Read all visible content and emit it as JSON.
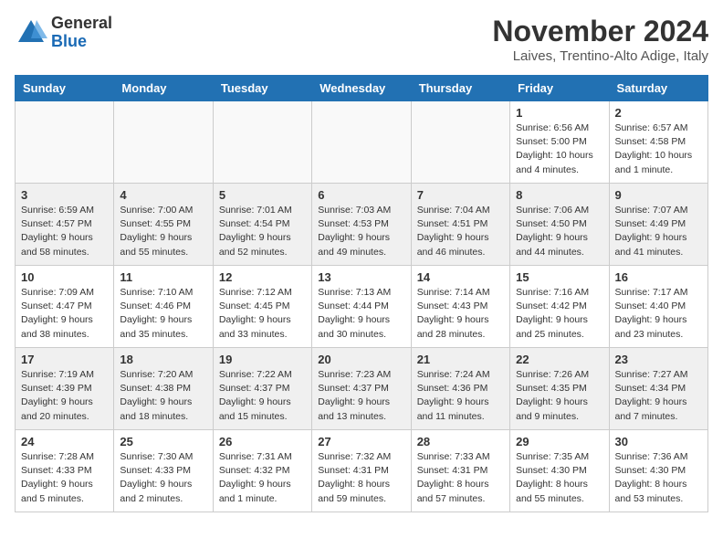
{
  "header": {
    "logo_general": "General",
    "logo_blue": "Blue",
    "month_title": "November 2024",
    "location": "Laives, Trentino-Alto Adige, Italy"
  },
  "columns": [
    "Sunday",
    "Monday",
    "Tuesday",
    "Wednesday",
    "Thursday",
    "Friday",
    "Saturday"
  ],
  "weeks": [
    [
      {
        "day": "",
        "info": "",
        "empty": true
      },
      {
        "day": "",
        "info": "",
        "empty": true
      },
      {
        "day": "",
        "info": "",
        "empty": true
      },
      {
        "day": "",
        "info": "",
        "empty": true
      },
      {
        "day": "",
        "info": "",
        "empty": true
      },
      {
        "day": "1",
        "info": "Sunrise: 6:56 AM\nSunset: 5:00 PM\nDaylight: 10 hours\nand 4 minutes.",
        "empty": false
      },
      {
        "day": "2",
        "info": "Sunrise: 6:57 AM\nSunset: 4:58 PM\nDaylight: 10 hours\nand 1 minute.",
        "empty": false
      }
    ],
    [
      {
        "day": "3",
        "info": "Sunrise: 6:59 AM\nSunset: 4:57 PM\nDaylight: 9 hours\nand 58 minutes.",
        "empty": false
      },
      {
        "day": "4",
        "info": "Sunrise: 7:00 AM\nSunset: 4:55 PM\nDaylight: 9 hours\nand 55 minutes.",
        "empty": false
      },
      {
        "day": "5",
        "info": "Sunrise: 7:01 AM\nSunset: 4:54 PM\nDaylight: 9 hours\nand 52 minutes.",
        "empty": false
      },
      {
        "day": "6",
        "info": "Sunrise: 7:03 AM\nSunset: 4:53 PM\nDaylight: 9 hours\nand 49 minutes.",
        "empty": false
      },
      {
        "day": "7",
        "info": "Sunrise: 7:04 AM\nSunset: 4:51 PM\nDaylight: 9 hours\nand 46 minutes.",
        "empty": false
      },
      {
        "day": "8",
        "info": "Sunrise: 7:06 AM\nSunset: 4:50 PM\nDaylight: 9 hours\nand 44 minutes.",
        "empty": false
      },
      {
        "day": "9",
        "info": "Sunrise: 7:07 AM\nSunset: 4:49 PM\nDaylight: 9 hours\nand 41 minutes.",
        "empty": false
      }
    ],
    [
      {
        "day": "10",
        "info": "Sunrise: 7:09 AM\nSunset: 4:47 PM\nDaylight: 9 hours\nand 38 minutes.",
        "empty": false
      },
      {
        "day": "11",
        "info": "Sunrise: 7:10 AM\nSunset: 4:46 PM\nDaylight: 9 hours\nand 35 minutes.",
        "empty": false
      },
      {
        "day": "12",
        "info": "Sunrise: 7:12 AM\nSunset: 4:45 PM\nDaylight: 9 hours\nand 33 minutes.",
        "empty": false
      },
      {
        "day": "13",
        "info": "Sunrise: 7:13 AM\nSunset: 4:44 PM\nDaylight: 9 hours\nand 30 minutes.",
        "empty": false
      },
      {
        "day": "14",
        "info": "Sunrise: 7:14 AM\nSunset: 4:43 PM\nDaylight: 9 hours\nand 28 minutes.",
        "empty": false
      },
      {
        "day": "15",
        "info": "Sunrise: 7:16 AM\nSunset: 4:42 PM\nDaylight: 9 hours\nand 25 minutes.",
        "empty": false
      },
      {
        "day": "16",
        "info": "Sunrise: 7:17 AM\nSunset: 4:40 PM\nDaylight: 9 hours\nand 23 minutes.",
        "empty": false
      }
    ],
    [
      {
        "day": "17",
        "info": "Sunrise: 7:19 AM\nSunset: 4:39 PM\nDaylight: 9 hours\nand 20 minutes.",
        "empty": false
      },
      {
        "day": "18",
        "info": "Sunrise: 7:20 AM\nSunset: 4:38 PM\nDaylight: 9 hours\nand 18 minutes.",
        "empty": false
      },
      {
        "day": "19",
        "info": "Sunrise: 7:22 AM\nSunset: 4:37 PM\nDaylight: 9 hours\nand 15 minutes.",
        "empty": false
      },
      {
        "day": "20",
        "info": "Sunrise: 7:23 AM\nSunset: 4:37 PM\nDaylight: 9 hours\nand 13 minutes.",
        "empty": false
      },
      {
        "day": "21",
        "info": "Sunrise: 7:24 AM\nSunset: 4:36 PM\nDaylight: 9 hours\nand 11 minutes.",
        "empty": false
      },
      {
        "day": "22",
        "info": "Sunrise: 7:26 AM\nSunset: 4:35 PM\nDaylight: 9 hours\nand 9 minutes.",
        "empty": false
      },
      {
        "day": "23",
        "info": "Sunrise: 7:27 AM\nSunset: 4:34 PM\nDaylight: 9 hours\nand 7 minutes.",
        "empty": false
      }
    ],
    [
      {
        "day": "24",
        "info": "Sunrise: 7:28 AM\nSunset: 4:33 PM\nDaylight: 9 hours\nand 5 minutes.",
        "empty": false
      },
      {
        "day": "25",
        "info": "Sunrise: 7:30 AM\nSunset: 4:33 PM\nDaylight: 9 hours\nand 2 minutes.",
        "empty": false
      },
      {
        "day": "26",
        "info": "Sunrise: 7:31 AM\nSunset: 4:32 PM\nDaylight: 9 hours\nand 1 minute.",
        "empty": false
      },
      {
        "day": "27",
        "info": "Sunrise: 7:32 AM\nSunset: 4:31 PM\nDaylight: 8 hours\nand 59 minutes.",
        "empty": false
      },
      {
        "day": "28",
        "info": "Sunrise: 7:33 AM\nSunset: 4:31 PM\nDaylight: 8 hours\nand 57 minutes.",
        "empty": false
      },
      {
        "day": "29",
        "info": "Sunrise: 7:35 AM\nSunset: 4:30 PM\nDaylight: 8 hours\nand 55 minutes.",
        "empty": false
      },
      {
        "day": "30",
        "info": "Sunrise: 7:36 AM\nSunset: 4:30 PM\nDaylight: 8 hours\nand 53 minutes.",
        "empty": false
      }
    ]
  ]
}
